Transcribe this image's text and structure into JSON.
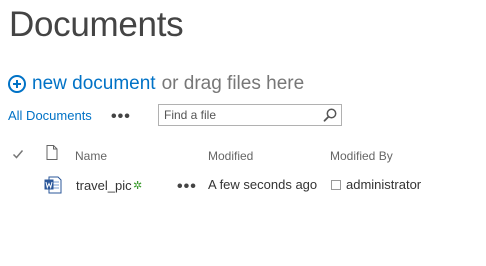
{
  "page": {
    "title": "Documents"
  },
  "toolbar": {
    "new_document_label": "new document",
    "drag_text": "or drag files here"
  },
  "views": {
    "current_view": "All Documents",
    "more_label": "•••"
  },
  "search": {
    "placeholder": "Find a file",
    "value": ""
  },
  "columns": {
    "name": "Name",
    "modified": "Modified",
    "modified_by": "Modified By"
  },
  "rows": [
    {
      "name": "travel_pic",
      "new_badge": "✲",
      "menu": "•••",
      "modified": "A few seconds ago",
      "modified_by": "administrator",
      "file_type_icon": "word-document-icon"
    }
  ],
  "colors": {
    "accent": "#0072c6",
    "new_badge": "#3a9b2c",
    "word_icon": "#2b579a"
  }
}
